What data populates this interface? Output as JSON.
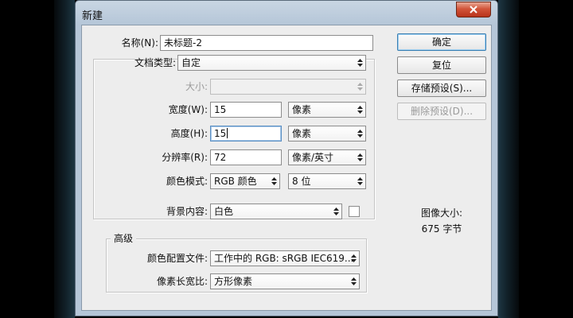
{
  "window": {
    "title": "新建"
  },
  "form": {
    "name_label": "名称(N):",
    "name_value": "未标题-2",
    "doc_type_label": "文档类型:",
    "doc_type_value": "自定",
    "size_label": "大小:",
    "size_value": "",
    "width_label": "宽度(W):",
    "width_value": "15",
    "width_unit": "像素",
    "height_label": "高度(H):",
    "height_value": "15",
    "height_unit": "像素",
    "resolution_label": "分辨率(R):",
    "resolution_value": "72",
    "resolution_unit": "像素/英寸",
    "color_mode_label": "颜色模式:",
    "color_mode_value": "RGB 颜色",
    "bit_depth_value": "8 位",
    "background_label": "背景内容:",
    "background_value": "白色",
    "background_swatch_color": "#ffffff"
  },
  "advanced": {
    "title": "高级",
    "color_profile_label": "颜色配置文件:",
    "color_profile_value": "工作中的 RGB: sRGB IEC619...",
    "pixel_aspect_label": "像素长宽比:",
    "pixel_aspect_value": "方形像素"
  },
  "buttons": {
    "ok": "确定",
    "reset": "复位",
    "save_preset": "存储预设(S)...",
    "delete_preset": "删除预设(D)..."
  },
  "image_size": {
    "label": "图像大小:",
    "value": "675 字节"
  },
  "colors": {
    "close_button": "#c8452a",
    "dialog_bg": "#ededed",
    "focus_border": "#5b8fc2"
  },
  "icons": {
    "close": "close-x-icon",
    "dropdown": "updown-arrow-icon"
  }
}
